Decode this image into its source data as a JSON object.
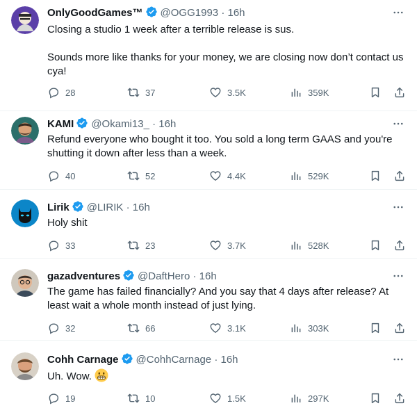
{
  "tweets": [
    {
      "name": "OnlyGoodGames™",
      "handle": "@OGG1993",
      "dot": "·",
      "time": "16h",
      "text": "Closing a studio 1 week after a terrible release is sus.\n\nSounds more like thanks for your money, we are closing now don’t contact us cya!",
      "replies": "28",
      "retweets": "37",
      "likes": "3.5K",
      "views": "359K",
      "avatar_color": "#5b3fa8"
    },
    {
      "name": "KAMI",
      "handle": "@Okami13_",
      "dot": "·",
      "time": "16h",
      "text": "Refund everyone who bought it too. You sold a long term GAAS and you're shutting it down after less than a week.",
      "replies": "40",
      "retweets": "52",
      "likes": "4.4K",
      "views": "529K",
      "avatar_color": "#2b6f6a"
    },
    {
      "name": "Lirik",
      "handle": "@LIRIK",
      "dot": "·",
      "time": "16h",
      "text": "Holy shit",
      "replies": "33",
      "retweets": "23",
      "likes": "3.7K",
      "views": "528K",
      "avatar_color": "#0c86c8"
    },
    {
      "name": "gazadventures",
      "handle": "@DaftHero",
      "dot": "·",
      "time": "16h",
      "text": "The game has failed financially? And you say that 4 days after release? At least wait a whole month instead of just lying.",
      "replies": "32",
      "retweets": "66",
      "likes": "3.1K",
      "views": "303K",
      "avatar_color": "#8a7a6a"
    },
    {
      "name": "Cohh Carnage",
      "handle": "@CohhCarnage",
      "dot": "·",
      "time": "16h",
      "text": "Uh. Wow.",
      "replies": "19",
      "retweets": "10",
      "likes": "1.5K",
      "views": "297K",
      "avatar_color": "#b08a6a"
    }
  ],
  "colors": {
    "verified": "#1d9bf0",
    "muted": "#536471",
    "text": "#0f1419"
  },
  "icons": [
    "verified-badge-icon",
    "more-icon",
    "reply-icon",
    "retweet-icon",
    "like-icon",
    "views-icon",
    "bookmark-icon",
    "share-icon",
    "grimace-emoji-icon"
  ]
}
